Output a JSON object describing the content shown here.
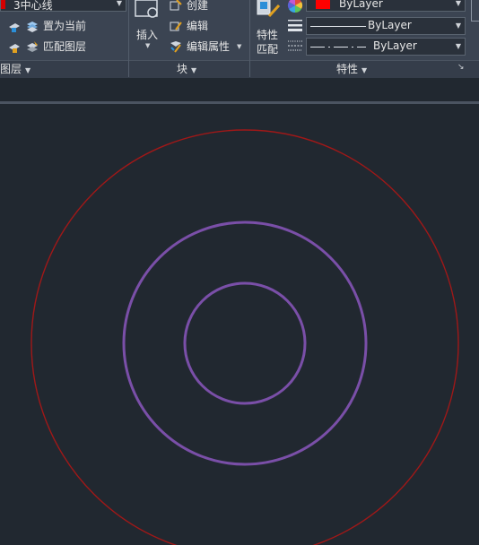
{
  "layers": {
    "current_layer": "3中心线",
    "layer_color": "#d40000",
    "set_current_label": "置为当前",
    "match_layer_label": "匹配图层",
    "footer_label": "图层"
  },
  "block": {
    "insert_label": "插入",
    "create_label": "创建",
    "edit_label": "编辑",
    "edit_attributes_label": "编辑属性",
    "footer_label": "块"
  },
  "properties": {
    "match_label_line1": "特性",
    "match_label_line2": "匹配",
    "color_value": "ByLayer",
    "color_swatch": "#ff0000",
    "lineweight_value": "ByLayer",
    "linetype_value": "ByLayer",
    "footer_label": "特性"
  },
  "drawing": {
    "outer_circle_color": "#a01818",
    "inner_circles_color": "#7a4fa8",
    "background": "#212830"
  }
}
